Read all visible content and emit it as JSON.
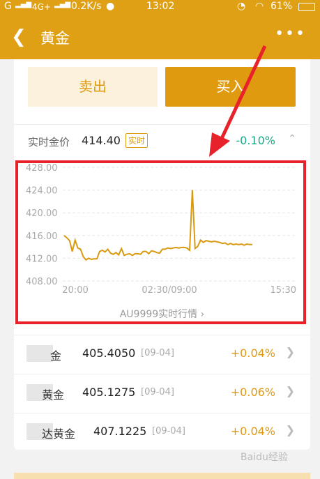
{
  "status_bar": {
    "signal": "G",
    "carrier": "4G+",
    "speed": "0.2K/s",
    "time": "13:02",
    "battery": "61%"
  },
  "nav": {
    "title": "黄金"
  },
  "actions": {
    "sell_label": "卖出",
    "buy_label": "买入"
  },
  "quote": {
    "label": "实时金价",
    "price": "414.40",
    "badge": "实时",
    "change": "-0.10%"
  },
  "chart_data": {
    "type": "line",
    "ylim": [
      408,
      428
    ],
    "yticks": [
      "428.00",
      "424.00",
      "420.00",
      "416.00",
      "412.00",
      "408.00"
    ],
    "xticks": [
      "20:00",
      "02:30/09:00",
      "15:30"
    ],
    "series": [
      {
        "values": [
          416.0,
          415.6,
          415.1,
          413.2,
          415.2,
          413.8,
          413.6,
          412.3,
          411.7,
          412.0,
          411.8,
          411.9,
          411.9,
          413.2,
          413.4,
          413.1,
          413.6,
          412.9,
          412.7,
          413.0,
          412.6,
          413.7,
          412.5,
          412.7,
          412.8,
          412.5,
          412.8,
          412.8,
          412.7,
          413.2,
          413.2,
          412.8,
          413.3,
          413.2,
          413.0,
          412.9,
          413.6,
          413.6,
          413.8,
          413.7,
          413.8,
          413.9,
          413.8,
          413.9,
          413.9,
          413.8,
          413.4,
          424.0,
          413.7,
          414.1,
          415.2,
          414.8,
          415.1,
          415.0,
          414.9,
          415.0,
          414.9,
          414.8,
          414.6,
          414.7,
          414.4,
          414.6,
          414.4,
          414.5,
          414.4,
          414.5,
          414.3,
          414.5,
          414.4,
          414.4
        ]
      }
    ]
  },
  "chart_link": "AU9999实时行情",
  "products": [
    {
      "name": "金",
      "price": "405.4050",
      "date": "[09-04]",
      "change": "+0.04%"
    },
    {
      "name": "黄金",
      "price": "405.1275",
      "date": "[09-04]",
      "change": "+0.06%"
    },
    {
      "name": "达黄金",
      "price": "407.1225",
      "date": "[09-04]",
      "change": "+0.04%"
    }
  ],
  "watermark": "Baidu经验",
  "colors": {
    "brand": "#e0a015",
    "line": "#d99a10",
    "annotation": "#e8222a",
    "down": "#16a884",
    "up": "#e09a10"
  }
}
